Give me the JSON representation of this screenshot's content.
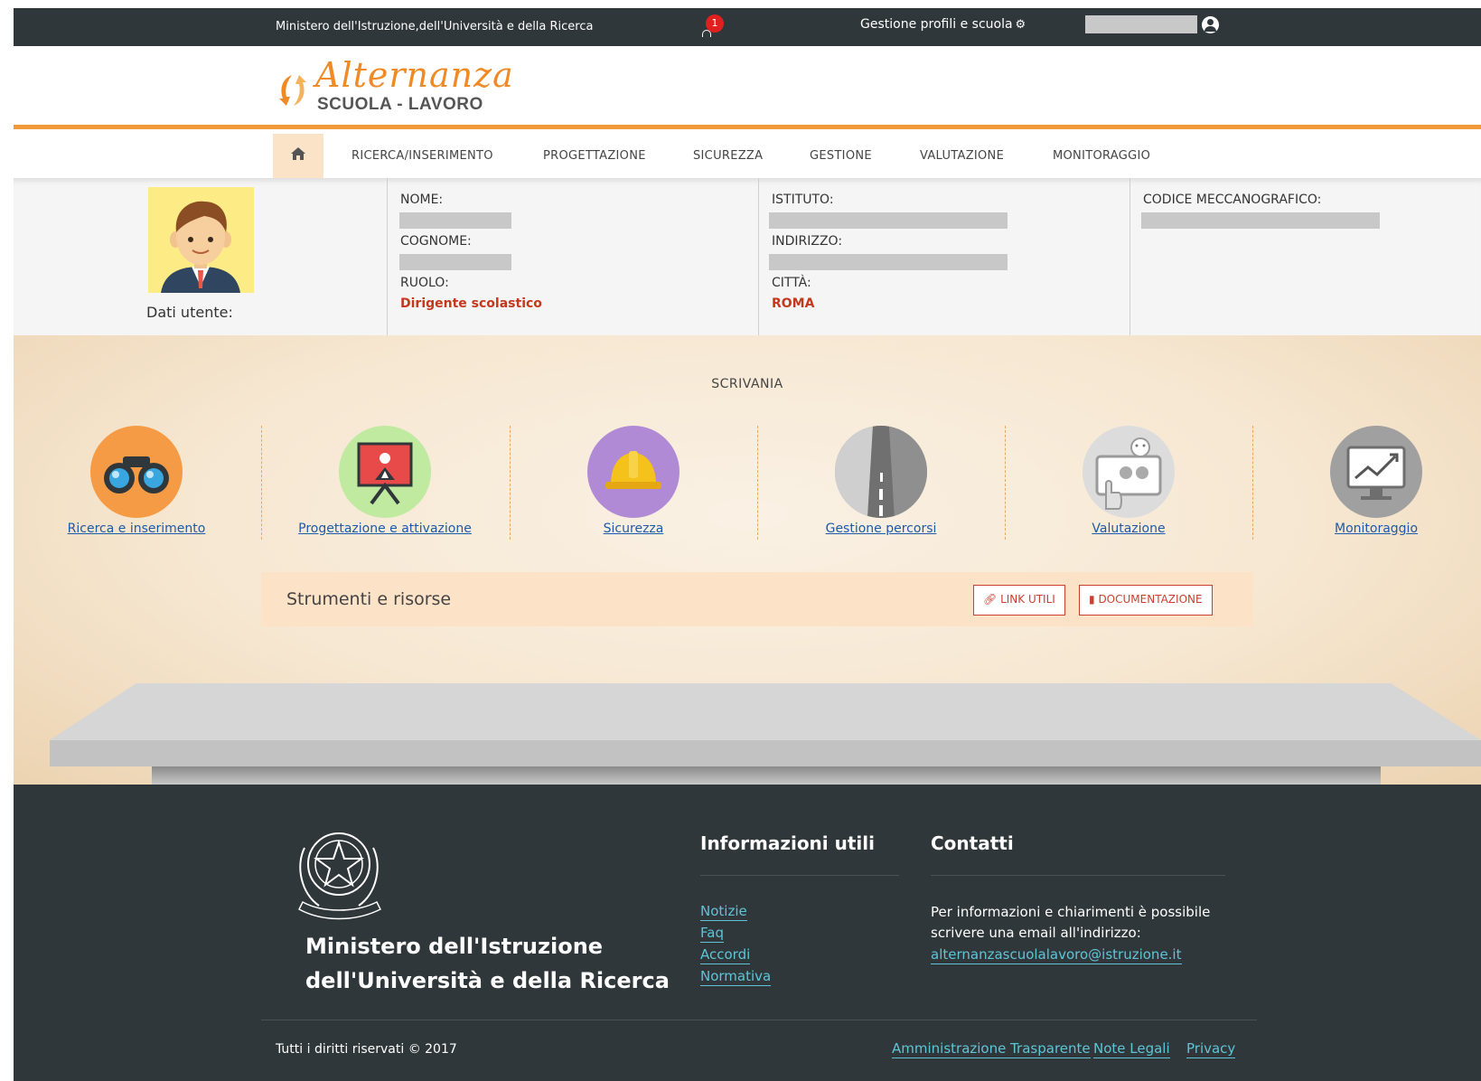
{
  "topbar": {
    "ministry": "Ministero dell'Istruzione,dell'Università e della Ricerca",
    "notification_count": "1",
    "profiles_label": "Gestione profili e scuola"
  },
  "logo": {
    "script_text": "Alternanza",
    "sub_text": "SCUOLA - LAVORO"
  },
  "nav": {
    "items": [
      "RICERCA/INSERIMENTO",
      "PROGETTAZIONE",
      "SICUREZZA",
      "GESTIONE",
      "VALUTAZIONE",
      "MONITORAGGIO"
    ]
  },
  "user": {
    "label": "Dati utente:",
    "nome_label": "NOME:",
    "cognome_label": "COGNOME:",
    "ruolo_label": "RUOLO:",
    "ruolo_value": "Dirigente scolastico",
    "istituto_label": "ISTITUTO:",
    "indirizzo_label": "INDIRIZZO:",
    "citta_label": "CITTÀ:",
    "citta_value": "ROMA",
    "codice_label": "CODICE MECCANOGRAFICO:"
  },
  "desk": {
    "title": "SCRIVANIA",
    "tools": [
      {
        "label": "Ricerca e inserimento",
        "icon": "binoculars-icon",
        "color": "#f59b45"
      },
      {
        "label": "Progettazione e attivazione",
        "icon": "presentation-icon",
        "color": "#bfeaa0"
      },
      {
        "label": "Sicurezza",
        "icon": "helmet-icon",
        "color": "#b18ad6"
      },
      {
        "label": "Gestione percorsi",
        "icon": "road-icon",
        "color": "#9a9a9a"
      },
      {
        "label": "Valutazione",
        "icon": "touchscreen-icon",
        "color": "#dcdcdc"
      },
      {
        "label": "Monitoraggio",
        "icon": "monitor-chart-icon",
        "color": "#a0a0a0"
      }
    ],
    "resources_title": "Strumenti e risorse",
    "link_utili": "LINK UTILI",
    "documentazione": "DOCUMENTAZIONE"
  },
  "footer": {
    "ministry_line1": "Ministero dell'Istruzione",
    "ministry_line2": "dell'Università e della Ricerca",
    "info_title": "Informazioni utili",
    "info_links": [
      "Notizie",
      "Faq",
      "Accordi",
      "Normativa"
    ],
    "contacts_title": "Contatti",
    "contacts_line1": "Per informazioni e chiarimenti è possibile",
    "contacts_line2": "scrivere una email all'indirizzo:",
    "contacts_email": "alternanzascuolalavoro@istruzione.it",
    "copyright": "Tutti i diritti riservati © 2017",
    "bottom_links": [
      "Amministrazione Trasparente",
      "Note Legali",
      "Privacy"
    ]
  },
  "colors": {
    "accent": "#f29a38",
    "topbar": "#30373b",
    "link": "#1e5aa8",
    "footer_link": "#5fc4d6",
    "red": "#c4391d"
  }
}
